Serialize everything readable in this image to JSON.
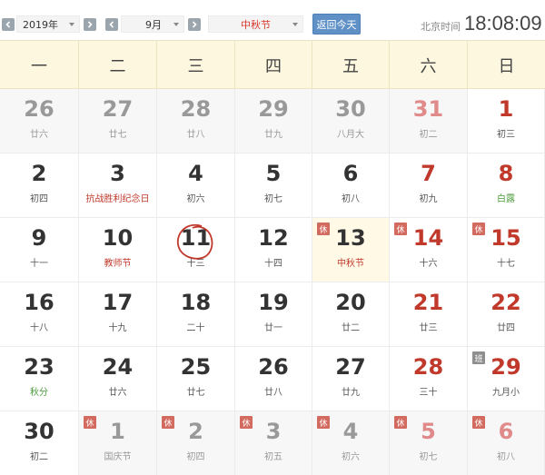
{
  "toolbar": {
    "year_value": "2019年",
    "month_value": "9月",
    "holiday_value": "中秋节",
    "today_label": "返回今天",
    "clock_label": "北京时间",
    "clock_time": "18:08:09"
  },
  "weekdays": [
    "一",
    "二",
    "三",
    "四",
    "五",
    "六",
    "日"
  ],
  "colors": {
    "accent": "#5f90c6",
    "weekend": "#c0392b",
    "header_bg": "#fcf7de",
    "rest_badge": "#d36a5f"
  },
  "weeks": [
    [
      {
        "d": "26",
        "l": "廿六",
        "other": true
      },
      {
        "d": "27",
        "l": "廿七",
        "other": true
      },
      {
        "d": "28",
        "l": "廿八",
        "other": true
      },
      {
        "d": "29",
        "l": "廿九",
        "other": true
      },
      {
        "d": "30",
        "l": "八月大",
        "other": true
      },
      {
        "d": "31",
        "l": "初二",
        "other": true,
        "wk": true
      },
      {
        "d": "1",
        "l": "初三",
        "wk": true
      }
    ],
    [
      {
        "d": "2",
        "l": "初四"
      },
      {
        "d": "3",
        "l": "抗战胜利纪念日",
        "lc": "red"
      },
      {
        "d": "4",
        "l": "初六"
      },
      {
        "d": "5",
        "l": "初七"
      },
      {
        "d": "6",
        "l": "初八"
      },
      {
        "d": "7",
        "l": "初九",
        "wk": true
      },
      {
        "d": "8",
        "l": "白露",
        "wk": true,
        "lc": "green"
      }
    ],
    [
      {
        "d": "9",
        "l": "十一"
      },
      {
        "d": "10",
        "l": "教师节",
        "lc": "red"
      },
      {
        "d": "11",
        "l": "十三",
        "circled": true
      },
      {
        "d": "12",
        "l": "十四"
      },
      {
        "d": "13",
        "l": "中秋节",
        "lc": "red",
        "badge": "休",
        "badgeType": "rest",
        "highlight": true
      },
      {
        "d": "14",
        "l": "十六",
        "wk": true,
        "badge": "休",
        "badgeType": "rest"
      },
      {
        "d": "15",
        "l": "十七",
        "wk": true,
        "badge": "休",
        "badgeType": "rest"
      }
    ],
    [
      {
        "d": "16",
        "l": "十八"
      },
      {
        "d": "17",
        "l": "十九"
      },
      {
        "d": "18",
        "l": "二十"
      },
      {
        "d": "19",
        "l": "廿一"
      },
      {
        "d": "20",
        "l": "廿二"
      },
      {
        "d": "21",
        "l": "廿三",
        "wk": true
      },
      {
        "d": "22",
        "l": "廿四",
        "wk": true
      }
    ],
    [
      {
        "d": "23",
        "l": "秋分",
        "lc": "green"
      },
      {
        "d": "24",
        "l": "廿六"
      },
      {
        "d": "25",
        "l": "廿七"
      },
      {
        "d": "26",
        "l": "廿八"
      },
      {
        "d": "27",
        "l": "廿九"
      },
      {
        "d": "28",
        "l": "三十",
        "wk": true
      },
      {
        "d": "29",
        "l": "九月小",
        "wk": true,
        "badge": "班",
        "badgeType": "work"
      }
    ],
    [
      {
        "d": "30",
        "l": "初二"
      },
      {
        "d": "1",
        "l": "国庆节",
        "other": true,
        "lc": "pink",
        "badge": "休",
        "badgeType": "rest"
      },
      {
        "d": "2",
        "l": "初四",
        "other": true,
        "lc": "pink",
        "badge": "休",
        "badgeType": "rest"
      },
      {
        "d": "3",
        "l": "初五",
        "other": true,
        "lc": "pink",
        "badge": "休",
        "badgeType": "rest"
      },
      {
        "d": "4",
        "l": "初六",
        "other": true,
        "lc": "pink",
        "badge": "休",
        "badgeType": "rest"
      },
      {
        "d": "5",
        "l": "初七",
        "other": true,
        "wk": true,
        "lc": "pink",
        "badge": "休",
        "badgeType": "rest"
      },
      {
        "d": "6",
        "l": "初八",
        "other": true,
        "wk": true,
        "lc": "pink",
        "badge": "休",
        "badgeType": "rest"
      }
    ]
  ]
}
